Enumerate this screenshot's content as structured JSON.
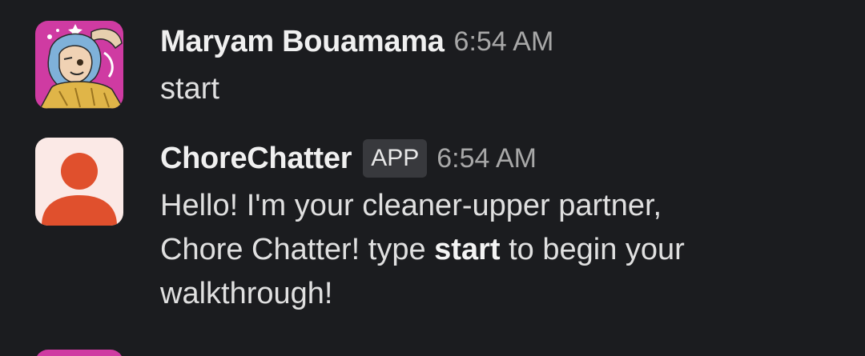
{
  "messages": [
    {
      "sender": "Maryam Bouamama",
      "time": "6:54 AM",
      "text": "start",
      "avatar_icon": "user-photo-avatar"
    },
    {
      "sender": "ChoreChatter",
      "badge": "APP",
      "time": "6:54 AM",
      "text_parts": {
        "line1": "Hello! I'm your cleaner-upper partner,",
        "line2_before": "Chore Chatter! type ",
        "line2_bold": "start",
        "line2_after": " to begin your",
        "line3": "walkthrough!"
      },
      "avatar_icon": "generic-user-avatar"
    }
  ],
  "colors": {
    "background": "#1b1c1f",
    "avatar_pink": "#cf3ba2",
    "avatar_orange": "#e0502d",
    "avatar_bg_light": "#fbe9e6"
  }
}
